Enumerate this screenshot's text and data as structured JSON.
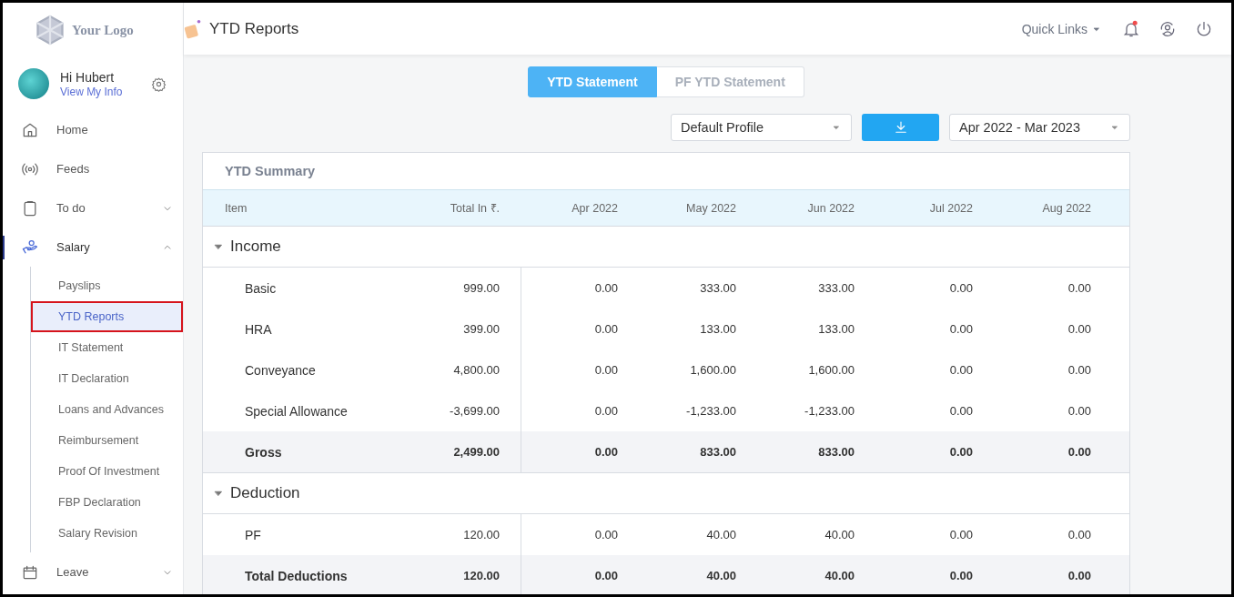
{
  "logo": {
    "text": "Your Logo"
  },
  "header": {
    "title": "YTD Reports",
    "quick_links": "Quick Links"
  },
  "user": {
    "greeting": "Hi Hubert",
    "link": "View My Info"
  },
  "sidebar": {
    "items": [
      {
        "label": "Home",
        "selected": false
      },
      {
        "label": "Feeds",
        "selected": false
      },
      {
        "label": "To do",
        "selected": false,
        "expanded": false
      },
      {
        "label": "Salary",
        "selected": true,
        "expanded": true,
        "children": [
          {
            "label": "Payslips",
            "selected": false
          },
          {
            "label": "YTD Reports",
            "selected": true
          },
          {
            "label": "IT Statement",
            "selected": false
          },
          {
            "label": "IT Declaration",
            "selected": false
          },
          {
            "label": "Loans and Advances",
            "selected": false
          },
          {
            "label": "Reimbursement",
            "selected": false
          },
          {
            "label": "Proof Of Investment",
            "selected": false
          },
          {
            "label": "FBP Declaration",
            "selected": false
          },
          {
            "label": "Salary Revision",
            "selected": false
          }
        ]
      },
      {
        "label": "Leave",
        "selected": false,
        "expanded": false
      }
    ]
  },
  "tabs": [
    {
      "label": "YTD Statement",
      "selected": true
    },
    {
      "label": "PF YTD Statement",
      "selected": false
    }
  ],
  "profile_select": {
    "value": "Default Profile"
  },
  "period_select": {
    "value": "Apr 2022 - Mar 2023"
  },
  "summary": {
    "title": "YTD Summary",
    "columns": [
      "Item",
      "Total In ₹.",
      "Apr 2022",
      "May 2022",
      "Jun 2022",
      "Jul 2022",
      "Aug 2022"
    ],
    "sections": [
      {
        "name": "Income",
        "expanded": true,
        "rows": [
          {
            "kind": "item",
            "cells": [
              "Basic",
              "999.00",
              "0.00",
              "333.00",
              "333.00",
              "0.00",
              "0.00"
            ]
          },
          {
            "kind": "item",
            "cells": [
              "HRA",
              "399.00",
              "0.00",
              "133.00",
              "133.00",
              "0.00",
              "0.00"
            ]
          },
          {
            "kind": "item",
            "cells": [
              "Conveyance",
              "4,800.00",
              "0.00",
              "1,600.00",
              "1,600.00",
              "0.00",
              "0.00"
            ]
          },
          {
            "kind": "item",
            "cells": [
              "Special Allowance",
              "-3,699.00",
              "0.00",
              "-1,233.00",
              "-1,233.00",
              "0.00",
              "0.00"
            ]
          },
          {
            "kind": "total",
            "cells": [
              "Gross",
              "2,499.00",
              "0.00",
              "833.00",
              "833.00",
              "0.00",
              "0.00"
            ]
          }
        ]
      },
      {
        "name": "Deduction",
        "expanded": true,
        "rows": [
          {
            "kind": "item",
            "cells": [
              "PF",
              "120.00",
              "0.00",
              "40.00",
              "40.00",
              "0.00",
              "0.00"
            ]
          },
          {
            "kind": "total",
            "cells": [
              "Total Deductions",
              "120.00",
              "0.00",
              "40.00",
              "40.00",
              "0.00",
              "0.00"
            ]
          }
        ]
      }
    ]
  }
}
